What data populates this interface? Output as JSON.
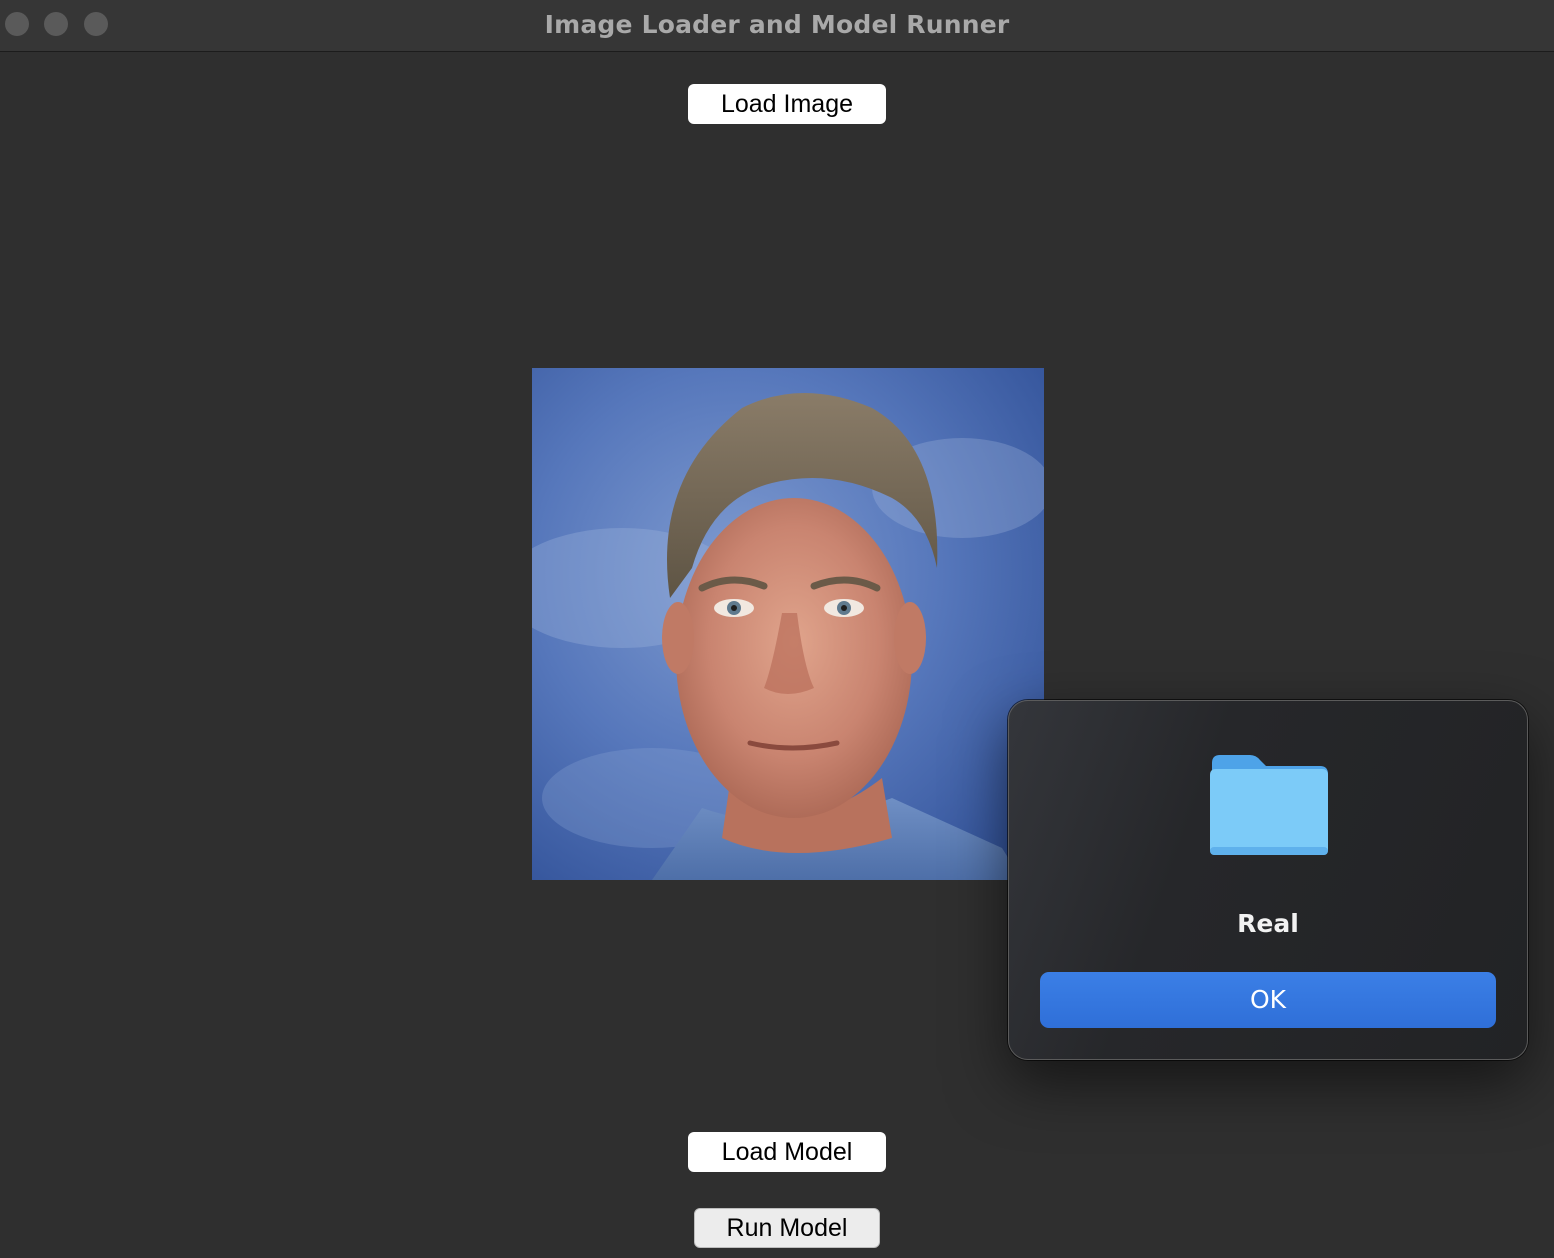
{
  "window": {
    "title": "Image Loader and Model Runner"
  },
  "toolbar": {
    "load_image_label": "Load Image",
    "load_model_label": "Load Model",
    "run_model_label": "Run Model"
  },
  "preview": {
    "description": "loaded-portrait-photo"
  },
  "dialog": {
    "icon": "folder-icon",
    "message": "Real",
    "ok_label": "OK",
    "accent_color": "#3478e4"
  },
  "colors": {
    "background": "#2f2f2f",
    "titlebar": "#363636",
    "button": "#ffffff"
  }
}
